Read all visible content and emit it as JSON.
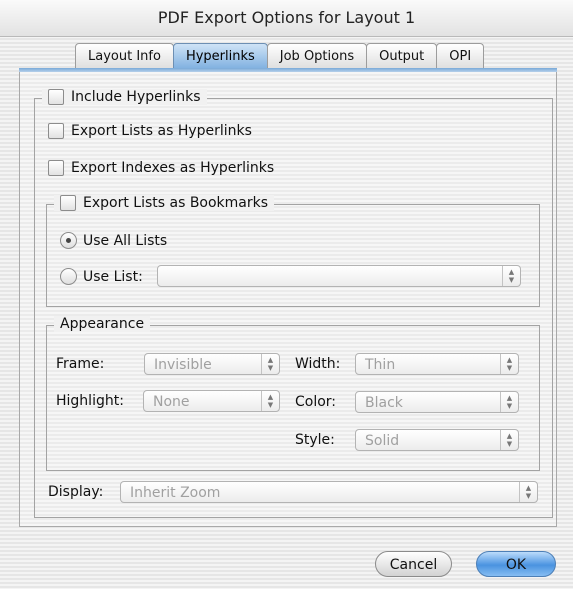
{
  "window": {
    "title": "PDF Export Options for Layout 1"
  },
  "tabs": [
    {
      "label": "Layout Info"
    },
    {
      "label": "Hyperlinks"
    },
    {
      "label": "Job Options"
    },
    {
      "label": "Output"
    },
    {
      "label": "OPI"
    }
  ],
  "active_tab": "Hyperlinks",
  "hyperlinks": {
    "include_hyperlinks": {
      "label": "Include Hyperlinks",
      "checked": false
    },
    "export_lists": {
      "label": "Export Lists as Hyperlinks",
      "checked": false
    },
    "export_indexes": {
      "label": "Export Indexes as Hyperlinks",
      "checked": false
    },
    "bookmarks": {
      "label": "Export Lists as Bookmarks",
      "checked": false,
      "use_all_lists": {
        "label": "Use All Lists",
        "selected": true
      },
      "use_list": {
        "label": "Use List:",
        "selected": false,
        "value": ""
      }
    },
    "appearance": {
      "label": "Appearance",
      "frame_label": "Frame:",
      "frame_value": "Invisible",
      "width_label": "Width:",
      "width_value": "Thin",
      "highlight_label": "Highlight:",
      "highlight_value": "None",
      "color_label": "Color:",
      "color_value": "Black",
      "style_label": "Style:",
      "style_value": "Solid"
    },
    "display_label": "Display:",
    "display_value": "Inherit Zoom"
  },
  "buttons": {
    "cancel": "Cancel",
    "ok": "OK"
  },
  "colors": {
    "accent": "#6fa8e0",
    "tab_active": "#7fb0e0"
  }
}
